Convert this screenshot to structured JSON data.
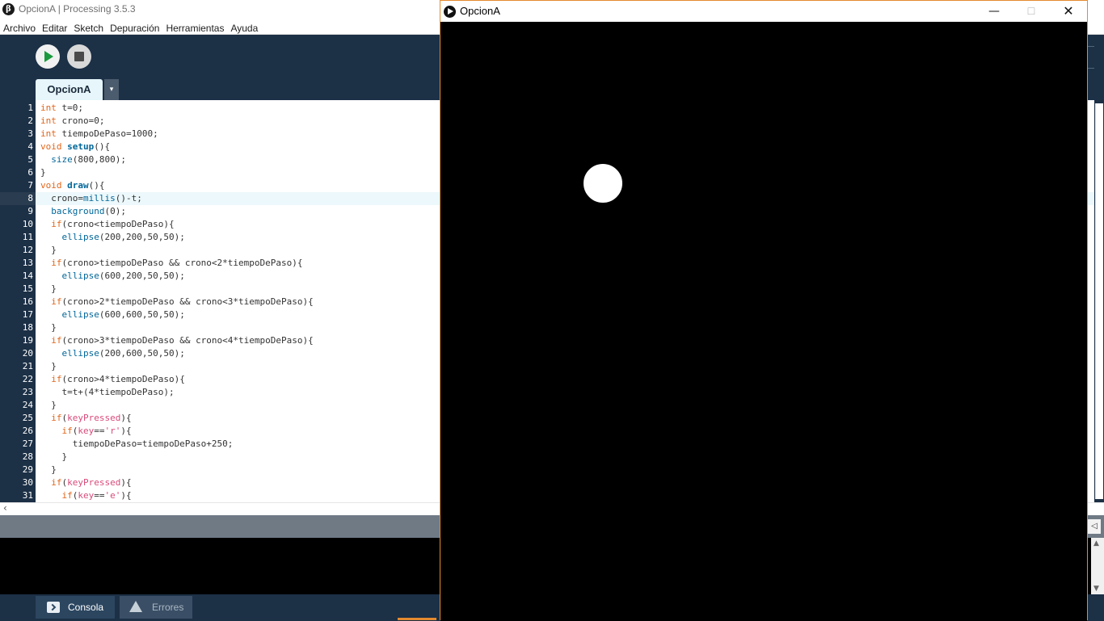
{
  "ide": {
    "title": "OpcionA | Processing 3.5.3",
    "logo": "β",
    "menu": [
      "Archivo",
      "Editar",
      "Sketch",
      "Depuración",
      "Herramientas",
      "Ayuda"
    ],
    "tab": "OpcionA",
    "tab_menu_icon": "▾",
    "current_line": 8,
    "lines": [
      [
        {
          "t": "int",
          "c": "kw-type"
        },
        {
          "t": " t=0;"
        }
      ],
      [
        {
          "t": "int",
          "c": "kw-type"
        },
        {
          "t": " crono=0;"
        }
      ],
      [
        {
          "t": "int",
          "c": "kw-type"
        },
        {
          "t": " tiempoDePaso=1000;"
        }
      ],
      [
        {
          "t": "void",
          "c": "kw-type"
        },
        {
          "t": " "
        },
        {
          "t": "setup",
          "c": "kw-fn"
        },
        {
          "t": "(){"
        }
      ],
      [
        {
          "t": "  "
        },
        {
          "t": "size",
          "c": "kw-blue"
        },
        {
          "t": "(800,800);"
        }
      ],
      [
        {
          "t": "}"
        }
      ],
      [
        {
          "t": "void",
          "c": "kw-type"
        },
        {
          "t": " "
        },
        {
          "t": "draw",
          "c": "kw-fn"
        },
        {
          "t": "(){"
        }
      ],
      [
        {
          "t": "  crono="
        },
        {
          "t": "millis",
          "c": "kw-blue"
        },
        {
          "t": "()-t;"
        }
      ],
      [
        {
          "t": "  "
        },
        {
          "t": "background",
          "c": "kw-blue"
        },
        {
          "t": "(0);"
        }
      ],
      [
        {
          "t": "  "
        },
        {
          "t": "if",
          "c": "kw-type"
        },
        {
          "t": "(crono<tiempoDePaso){"
        }
      ],
      [
        {
          "t": "    "
        },
        {
          "t": "ellipse",
          "c": "kw-blue"
        },
        {
          "t": "(200,200,50,50);"
        }
      ],
      [
        {
          "t": "  }"
        }
      ],
      [
        {
          "t": "  "
        },
        {
          "t": "if",
          "c": "kw-type"
        },
        {
          "t": "(crono>tiempoDePaso && crono<2*tiempoDePaso){"
        }
      ],
      [
        {
          "t": "    "
        },
        {
          "t": "ellipse",
          "c": "kw-blue"
        },
        {
          "t": "(600,200,50,50);"
        }
      ],
      [
        {
          "t": "  }"
        }
      ],
      [
        {
          "t": "  "
        },
        {
          "t": "if",
          "c": "kw-type"
        },
        {
          "t": "(crono>2*tiempoDePaso && crono<3*tiempoDePaso){"
        }
      ],
      [
        {
          "t": "    "
        },
        {
          "t": "ellipse",
          "c": "kw-blue"
        },
        {
          "t": "(600,600,50,50);"
        }
      ],
      [
        {
          "t": "  }"
        }
      ],
      [
        {
          "t": "  "
        },
        {
          "t": "if",
          "c": "kw-type"
        },
        {
          "t": "(crono>3*tiempoDePaso && crono<4*tiempoDePaso){"
        }
      ],
      [
        {
          "t": "    "
        },
        {
          "t": "ellipse",
          "c": "kw-blue"
        },
        {
          "t": "(200,600,50,50);"
        }
      ],
      [
        {
          "t": "  }"
        }
      ],
      [
        {
          "t": "  "
        },
        {
          "t": "if",
          "c": "kw-type"
        },
        {
          "t": "(crono>4*tiempoDePaso){"
        }
      ],
      [
        {
          "t": "    t=t+(4*tiempoDePaso);"
        }
      ],
      [
        {
          "t": "  }"
        }
      ],
      [
        {
          "t": "  "
        },
        {
          "t": "if",
          "c": "kw-type"
        },
        {
          "t": "("
        },
        {
          "t": "keyPressed",
          "c": "kw-pink"
        },
        {
          "t": "){"
        }
      ],
      [
        {
          "t": "    "
        },
        {
          "t": "if",
          "c": "kw-type"
        },
        {
          "t": "("
        },
        {
          "t": "key",
          "c": "kw-pink"
        },
        {
          "t": "=="
        },
        {
          "t": "'r'",
          "c": "kw-pink"
        },
        {
          "t": "){"
        }
      ],
      [
        {
          "t": "      tiempoDePaso=tiempoDePaso+250;"
        }
      ],
      [
        {
          "t": "    }"
        }
      ],
      [
        {
          "t": "  }"
        }
      ],
      [
        {
          "t": "  "
        },
        {
          "t": "if",
          "c": "kw-type"
        },
        {
          "t": "("
        },
        {
          "t": "keyPressed",
          "c": "kw-pink"
        },
        {
          "t": "){"
        }
      ],
      [
        {
          "t": "    "
        },
        {
          "t": "if",
          "c": "kw-type"
        },
        {
          "t": "("
        },
        {
          "t": "key",
          "c": "kw-pink"
        },
        {
          "t": "=="
        },
        {
          "t": "'e'",
          "c": "kw-pink"
        },
        {
          "t": "){"
        }
      ]
    ],
    "footer": {
      "console_label": "Consola",
      "errors_label": "Errores"
    },
    "colors": {
      "background": "#1c3046",
      "run_green": "#1a9a3c",
      "keyword_orange": "#e2661a",
      "function_blue": "#006699",
      "pink": "#d94a7a"
    }
  },
  "sketch": {
    "title": "OpcionA",
    "minimize": "—",
    "maximize": "☐",
    "close": "✕"
  }
}
